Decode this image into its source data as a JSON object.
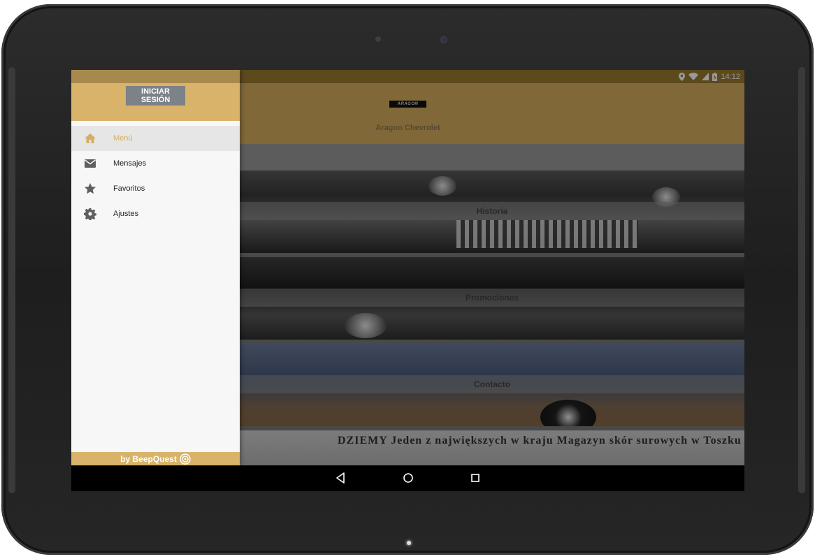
{
  "device": {
    "type": "android-tablet"
  },
  "status_bar": {
    "time": "14:12",
    "icons": [
      "location-icon",
      "wifi-icon",
      "signal-icon",
      "battery-icon"
    ]
  },
  "app_bar": {
    "logo_text": "ARAGON",
    "title": "Aragon Chevrolet"
  },
  "cards": [
    {
      "label": "Historia"
    },
    {
      "label": "Promociones"
    },
    {
      "label": "Contacto"
    },
    {
      "label": ""
    }
  ],
  "background_newspaper_text": "DZIEMY    Jeden z największych w kraju    Magazyn skór surowych w Toszku",
  "drawer": {
    "login_button": "INICIAR SESIÓN",
    "items": [
      {
        "label": "Menú",
        "icon": "home-icon",
        "active": true
      },
      {
        "label": "Mensajes",
        "icon": "envelope-icon",
        "active": false
      },
      {
        "label": "Favoritos",
        "icon": "star-icon",
        "active": false
      },
      {
        "label": "Ajustes",
        "icon": "gear-icon",
        "active": false
      }
    ],
    "footer": "by BeepQuest"
  },
  "nav_bar": {
    "buttons": [
      "back-icon",
      "home-circle-icon",
      "recents-icon"
    ]
  },
  "colors": {
    "accent": "#d8b369",
    "active_text": "#d8ad5d",
    "drawer_bg": "#f7f7f7",
    "login_button_bg": "#7c8287"
  }
}
